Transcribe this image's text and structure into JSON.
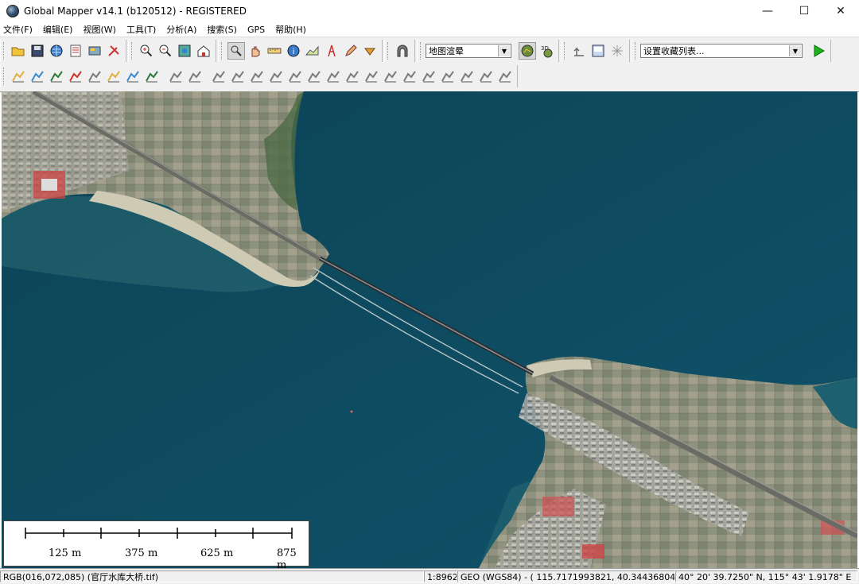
{
  "window": {
    "title": "Global Mapper v14.1 (b120512) - REGISTERED",
    "controls": {
      "minimize": "—",
      "maximize": "☐",
      "close": "✕"
    }
  },
  "menu": {
    "items": [
      {
        "label": "文件(F)"
      },
      {
        "label": "编辑(E)"
      },
      {
        "label": "视图(W)"
      },
      {
        "label": "工具(T)"
      },
      {
        "label": "分析(A)"
      },
      {
        "label": "搜索(S)"
      },
      {
        "label": "GPS"
      },
      {
        "label": "帮助(H)"
      }
    ]
  },
  "toolbar": {
    "shader_combo": {
      "value": "地图渲晕"
    },
    "bookmark_combo": {
      "value": "设置收藏列表..."
    },
    "icons_row1_group1": [
      "open-folder-icon",
      "save-icon",
      "globe-icon",
      "layer-control-icon",
      "config-icon",
      "tools-icon"
    ],
    "icons_row1_group2": [
      "zoom-in-icon",
      "zoom-out-icon",
      "full-view-icon",
      "home-icon"
    ],
    "icons_row1_group3": [
      "zoom-tool-icon",
      "pan-tool-icon",
      "measure-tool-icon",
      "info-tool-icon",
      "profile-tool-icon",
      "tower-tool-icon",
      "digitizer-tool-icon",
      "3d-path-tool-icon"
    ],
    "icons_row1_group4": [
      "tunnel-icon"
    ],
    "icons_row1_group5": [
      "shader-settings-icon",
      "3d-view-icon"
    ],
    "icons_row1_group6": [
      "back-icon",
      "map-layout-icon",
      "sparkle-icon"
    ],
    "play_icon": "play-icon",
    "icons_row2": [
      "create-area-icon",
      "create-line-icon",
      "feature-edit-icon",
      "feature-split-icon",
      "create-point-icon",
      "cad-import-icon",
      "buffer-icon",
      "grid-icon",
      "vertex-add-icon",
      "vertex-move-icon",
      "draw-line-icon",
      "smooth-area-icon",
      "cut-area-icon",
      "split-line-icon",
      "join-line-icon",
      "union-area-icon",
      "intersect-area-icon",
      "circle-area-icon",
      "grid-split-icon",
      "rotate-icon",
      "area-fill-icon",
      "area-edit-icon",
      "area-shape-icon",
      "angle-left-icon",
      "angle-up-icon",
      "undo-curve-icon"
    ],
    "accent_green": "#1db31d"
  },
  "map": {
    "scalebar": {
      "labels": [
        "125 m",
        "375 m",
        "625 m",
        "875 m"
      ]
    },
    "colors": {
      "water": "#0f4b5f",
      "land": "#9a9a88",
      "shore": "#c9c4b0"
    }
  },
  "statusbar": {
    "pixel_info": "RGB(016,072,085) (官厅水库大桥.tif)",
    "scale": "1:8962",
    "coords": "GEO (WGS84) - ( 115.7171993821, 40.3443680434 )",
    "dms": "40° 20' 39.7250\" N, 115° 43' 1.9178\" E"
  }
}
